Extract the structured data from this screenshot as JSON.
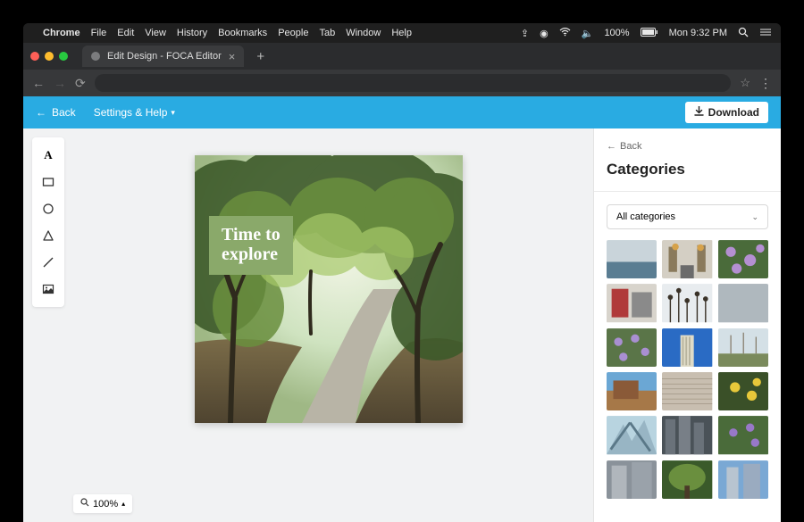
{
  "macmenu": {
    "app": "Chrome",
    "items": [
      "File",
      "Edit",
      "View",
      "History",
      "Bookmarks",
      "People",
      "Tab",
      "Window",
      "Help"
    ],
    "battery": "100%",
    "clock": "Mon 9:32 PM"
  },
  "browser": {
    "tab_title": "Edit Design - FOCA Editor"
  },
  "header": {
    "back_label": "Back",
    "settings_label": "Settings & Help",
    "download_label": "Download"
  },
  "tools": {
    "items": [
      {
        "name": "text-tool",
        "icon": "A"
      },
      {
        "name": "rectangle-tool",
        "icon": "rect"
      },
      {
        "name": "ellipse-tool",
        "icon": "circle"
      },
      {
        "name": "triangle-tool",
        "icon": "triangle"
      },
      {
        "name": "line-tool",
        "icon": "line"
      },
      {
        "name": "image-tool",
        "icon": "image"
      }
    ]
  },
  "canvas": {
    "label_line1": "Time to",
    "label_line2": "explore"
  },
  "zoom": {
    "value": "100%"
  },
  "rightpanel": {
    "back_label": "Back",
    "title": "Categories",
    "select_label": "All categories"
  }
}
